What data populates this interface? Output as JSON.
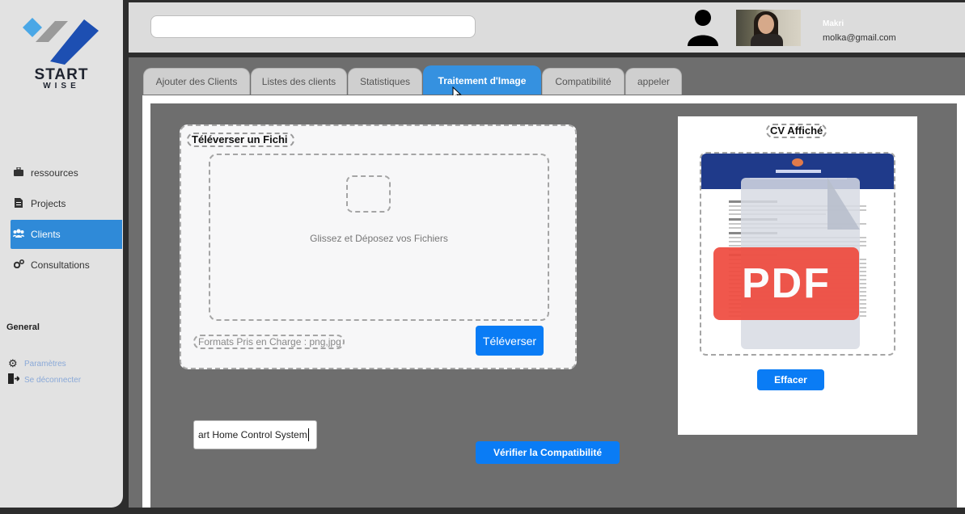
{
  "app": {
    "logo_start": "START",
    "logo_wise": "WISE"
  },
  "sidebar": {
    "items": [
      {
        "label": "ressources",
        "icon": "briefcase-icon"
      },
      {
        "label": "Projects",
        "icon": "document-icon"
      },
      {
        "label": "Clients",
        "icon": "users-icon",
        "active": true
      },
      {
        "label": "Consultations",
        "icon": "gears-icon"
      }
    ],
    "general_label": "General",
    "settings_label": "Paramètres",
    "logout_label": "Se déconnecter"
  },
  "header": {
    "search_value": "",
    "user_name": "Makri",
    "user_email": "molka@gmail.com"
  },
  "tabs": [
    {
      "label": "Ajouter des Clients"
    },
    {
      "label": "Listes des clients"
    },
    {
      "label": "Statistiques"
    },
    {
      "label": "Traitement d'Image",
      "active": true
    },
    {
      "label": "Compatibilité"
    },
    {
      "label": "appeler"
    }
  ],
  "upload": {
    "title": "Téléverser un Fichi",
    "drop_text": "Glissez et Déposez vos Fichiers",
    "formats": "Formats Pris en Charge : png,jpg",
    "button": "Téléverser"
  },
  "project": {
    "input_value": "art Home Control System",
    "verify_button": "Vérifier la Compatibilité"
  },
  "cv": {
    "title": "CV Affiché",
    "pdf_label": "PDF",
    "clear_button": "Effacer"
  },
  "colors": {
    "accent": "#0a7cf5",
    "active_tab": "#3591e0",
    "active_nav": "#2f8ad8",
    "pdf_red": "#ef4b3f"
  }
}
